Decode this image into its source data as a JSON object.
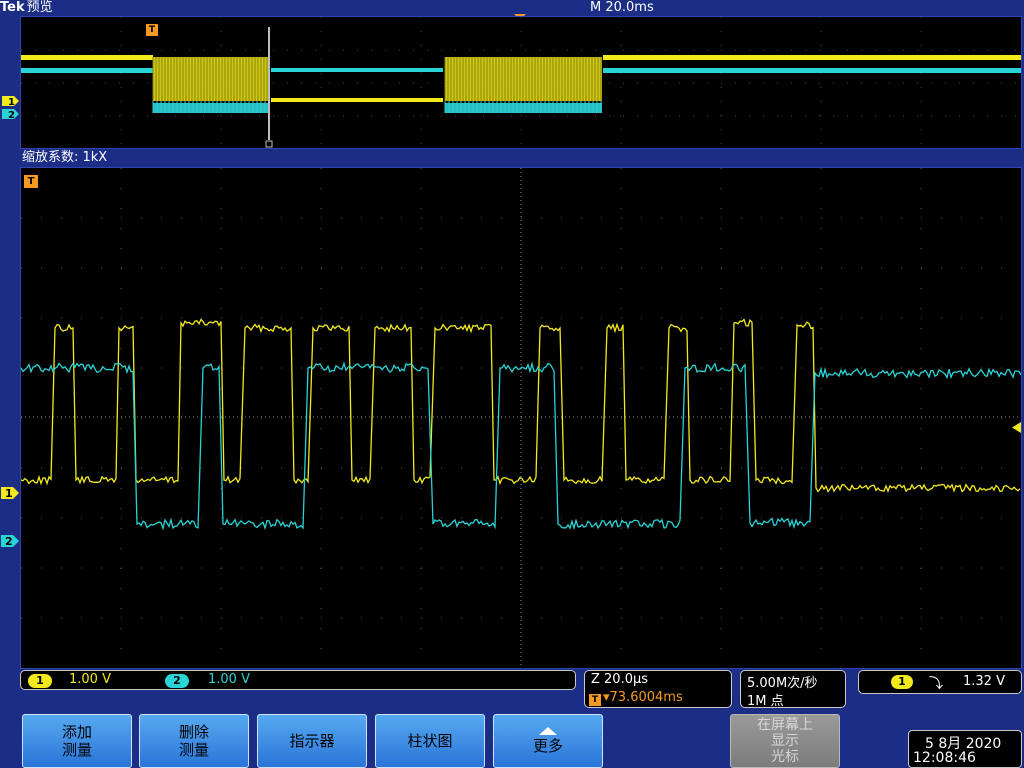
{
  "header": {
    "brand": "Tek",
    "mode": "预览",
    "timebase": "M 20.0ms"
  },
  "overview": {
    "zoom_label": "缩放系数: 1kX",
    "trigger_marker": "T",
    "ch1_marker": "1",
    "ch2_marker": "2"
  },
  "main": {
    "trigger_marker": "T",
    "ch1_marker": "1",
    "ch2_marker": "2"
  },
  "status": {
    "ch1_chip": "1",
    "ch1_scale": "1.00 V",
    "ch2_chip": "2",
    "ch2_scale": "1.00 V",
    "zoom_time": "Z 20.0μs",
    "trigger_position": "▾73.6004ms",
    "sample_rate": "5.00M次/秒",
    "record_length": "1M 点",
    "trigger_chip": "1",
    "trigger_slope": "⤵",
    "trigger_level": "1.32 V"
  },
  "softkeys": {
    "add_measure": "添加\n测量",
    "delete_measure": "删除\n测量",
    "indicator": "指示器",
    "histogram": "柱状图",
    "more": "更多",
    "on_screen_cursor": "在屏幕上\n显示\n光标"
  },
  "clock": {
    "date": "5 8月  2020",
    "time": "12:08:46"
  },
  "colors": {
    "ch1": "#f2ea1d",
    "ch2": "#2ad3d6",
    "trigger": "#f59a20",
    "frame": "#1c2d86"
  }
}
